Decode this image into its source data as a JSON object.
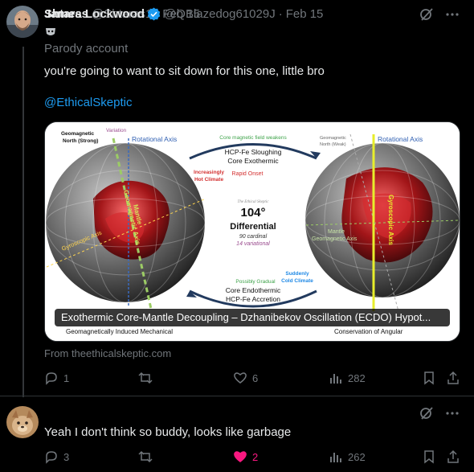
{
  "tweets": [
    {
      "name": "Shtaras",
      "handle": "@Shtaras1",
      "date": "Feb 15",
      "parody_label": "Parody account",
      "text": "you're going to want to sit down for this one, little bro",
      "mention": "@EthicalSkeptic",
      "card": {
        "caption": "Exothermic Core-Mantle Decoupling – Dzhanibekov Oscillation (ECDO) Hypot...",
        "source": "From theethicalskeptic.com",
        "image_text": {
          "geomagnetic_north_strong": "Geomagnetic North (Strong)",
          "variation": "Variation",
          "rotational_axis_left": "Rotational Axis",
          "core_weakens": "Core magnetic field weakens",
          "hcp_sloughing_1": "HCP-Fe Sloughing",
          "hcp_sloughing_2": "Core Exothermic",
          "increasingly_1": "Increasingly",
          "increasingly_2": "Hot Climate",
          "rapid_onset": "Rapid Onset",
          "geomagnetic_north_weak": "Geomagnetic North (Weak)",
          "rotational_axis_right": "Rotational Axis",
          "mantle_geomagnetic_axis": "Mantle Geomagnetic Axis",
          "gyroscopic_axis_left": "Gyroscopic Axis",
          "ethical_skeptic": "The Ethical Skeptic",
          "degrees": "104°",
          "differential": "Differential",
          "cardinal": "90 cardinal",
          "variational": "14 variational",
          "gyroscopic_axis_right": "Gyroscopic Axis",
          "mantle_geo_right_1": "Mantle",
          "mantle_geo_right_2": "Geomagnetic Axis",
          "suddenly_1": "Suddenly",
          "suddenly_2": "Cold Climate",
          "possibly_gradual": "Possibly Gradual",
          "core_endo_1": "Core Endothermic",
          "core_endo_2": "HCP-Fe Accretion",
          "bottom_left": "Geomagnetically Induced Mechanical",
          "bottom_right": "Conservation of Angular"
        }
      },
      "stats": {
        "replies": "1",
        "retweets": "",
        "likes": "6",
        "views": "282"
      }
    },
    {
      "name": "James Lockwood",
      "handle": "@QBlazedog61029J",
      "date": "Feb 15",
      "text": "Yeah I don't think so buddy, looks like garbage",
      "stats": {
        "replies": "3",
        "retweets": "",
        "likes": "2",
        "views": "262"
      }
    }
  ],
  "colors": {
    "background": "#000000",
    "text": "#e7e9ea",
    "secondary": "#71767b",
    "link": "#1d9bf0",
    "like_active": "#f91880",
    "verified": "#1d9bf0"
  },
  "icons": {
    "grok": "grok-icon",
    "more": "more-icon",
    "reply": "reply-icon",
    "retweet": "retweet-icon",
    "like": "heart-icon",
    "views": "views-icon",
    "bookmark": "bookmark-icon",
    "share": "share-icon",
    "parody": "mask-icon"
  }
}
